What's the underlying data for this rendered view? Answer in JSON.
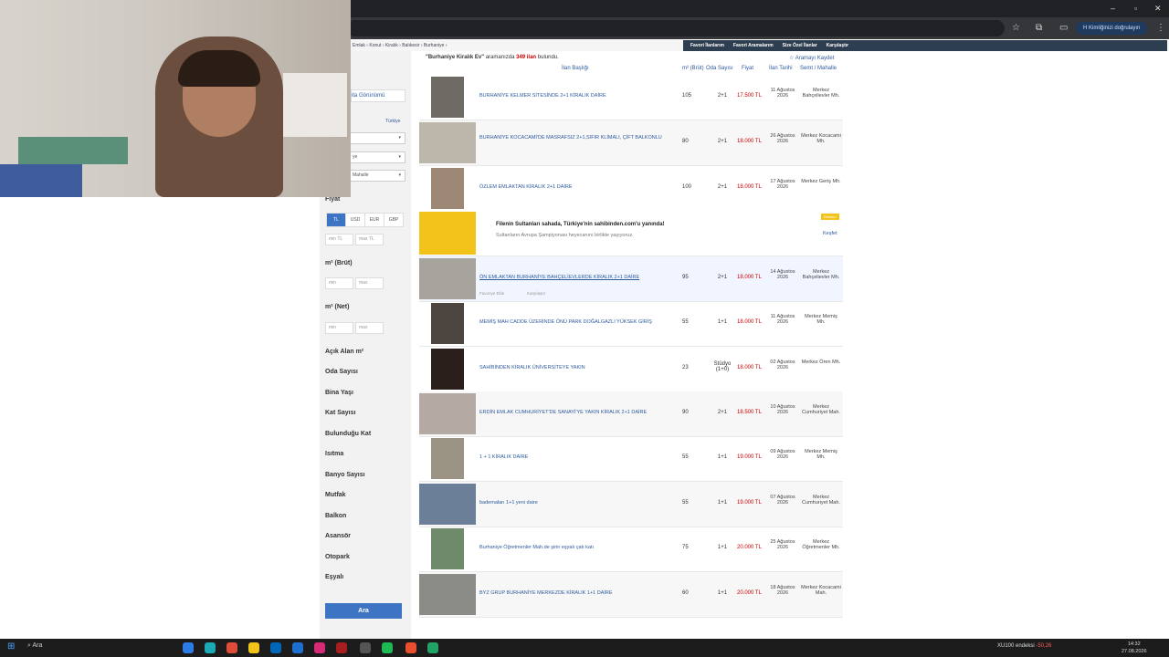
{
  "browser": {
    "verify_label": "Kimliğinizi doğrulayın",
    "avatar_letter": "H"
  },
  "breadcrumb": [
    "Emlak",
    "Konut",
    "Kiralık",
    "Balıkesir",
    "Burhaniye"
  ],
  "fav_links": [
    "Favori İlanlarım",
    "Favori Aramalarım",
    "Size Özel İlanlar",
    "Karşılaştır"
  ],
  "search_info": {
    "query": "\"Burhaniye Kiralık Ev\"",
    "prefix": "aramanızda",
    "count": "349 ilan",
    "suffix": "bulundu.",
    "save": "Aramayı Kaydet"
  },
  "sidebar": {
    "map_view": "ita Görünümü",
    "country": "Türkiye",
    "select2": "ye",
    "neighborhood": "Mahalle",
    "price_label": "Fiyat",
    "currencies": [
      "TL",
      "USD",
      "EUR",
      "GBP"
    ],
    "min_tl": "min TL",
    "max_tl": "max TL",
    "m2_brut": "m² (Brüt)",
    "m2_net": "m² (Net)",
    "min": "min",
    "max": "max",
    "filters": [
      "Açık Alan m²",
      "Oda Sayısı",
      "Bina Yaşı",
      "Kat Sayısı",
      "Bulunduğu Kat",
      "Isıtma",
      "Banyo Sayısı",
      "Mutfak",
      "Balkon",
      "Asansör",
      "Otopark",
      "Eşyalı"
    ],
    "search_button": "Ara"
  },
  "table": {
    "headers": [
      "İlan Başlığı",
      "m² (Brüt)",
      "Oda Sayısı",
      "Fiyat",
      "İlan Tarihi",
      "Semt / Mahalle"
    ],
    "rows": [
      {
        "title": "BURHANİYE KELMER SİTESİNDE 2+1 KİRALIK DAİRE",
        "m2": "105",
        "room": "2+1",
        "price": "17.500 TL",
        "date": "11 Ağustos 2026",
        "loc": "Merkez Bahçelievler Mh."
      },
      {
        "title": "BURHANİYE KOCACAMİ'DE MASRAFSIZ 2+1,SIFIR KLİMALI, ÇİFT BALKONLU",
        "m2": "80",
        "room": "2+1",
        "price": "18.000 TL",
        "date": "26 Ağustos 2026",
        "loc": "Merkez Kocacami Mh."
      },
      {
        "title": "ÖZLEM EMLAKTAN KİRALIK 2+1 DAİRE",
        "m2": "100",
        "room": "2+1",
        "price": "18.000 TL",
        "date": "17 Ağustos 2026",
        "loc": "Merkez Geriş Mh."
      },
      {
        "title": "ÖN EMLAKTAN BURHANİYE BAHÇELİEVLERDE KİRALIK 2+1 DAİRE",
        "m2": "95",
        "room": "2+1",
        "price": "18.000 TL",
        "date": "14 Ağustos 2026",
        "loc": "Merkez Bahçelievler Mh."
      },
      {
        "title": "MEMİŞ MAH CADDE ÜZERİNDE ÖNÜ PARK DOĞALGAZLI YÜKSEK GİRİŞ",
        "m2": "55",
        "room": "1+1",
        "price": "18.000 TL",
        "date": "11 Ağustos 2026",
        "loc": "Merkez Memiş Mh."
      },
      {
        "title": "SAHİBİNDEN KİRALIK ÜNİVERSİTEYE YAKIN",
        "m2": "23",
        "room": "Stüdyo (1+0)",
        "price": "18.000 TL",
        "date": "02 Ağustos 2026",
        "loc": "Merkez Ören Mh."
      },
      {
        "title": "ERDİN EMLAK CUMHURİYET'DE SANAYİ'YE YAKIN KİRALIK 2+1 DAİRE",
        "m2": "90",
        "room": "2+1",
        "price": "18.500 TL",
        "date": "10 Ağustos 2026",
        "loc": "Merkez Cumhuriyet Mah."
      },
      {
        "title": "1 + 1 KİRALIK DAİRE",
        "m2": "55",
        "room": "1+1",
        "price": "19.000 TL",
        "date": "09 Ağustos 2026",
        "loc": "Merkez Memiş Mh."
      },
      {
        "title": "bademaları 1+1 yeni daire",
        "m2": "55",
        "room": "1+1",
        "price": "19.000 TL",
        "date": "07 Ağustos 2026",
        "loc": "Merkez Cumhuriyet Mah."
      },
      {
        "title": "Burhaniye Öğretmenler Mah.de şirin eşyalı çatı katı",
        "m2": "75",
        "room": "1+1",
        "price": "20.000 TL",
        "date": "25 Ağustos 2026",
        "loc": "Merkez Öğretmenler Mh."
      },
      {
        "title": "BYZ GRUP BURHANİYE MERKEZDE KİRALIK 1+1 DAİRE",
        "m2": "60",
        "room": "1+1",
        "price": "20.000 TL",
        "date": "18 Ağustos 2026",
        "loc": "Merkez Kocacami Mah."
      }
    ],
    "ad": {
      "line1": "Filenin Sultanları sahada, Türkiye'nin sahibinden.com'u yanında!",
      "line2": "Sultanların Avrupa Şampiyonası heyecanını birlikte yaşıyoruz.",
      "badge": "Reklam",
      "cta": "Keşfet"
    },
    "row_actions": [
      "Favoriye Ekle",
      "Karşılaştır"
    ]
  },
  "taskbar": {
    "search": "Ara",
    "ticker": "XU100 endeksi",
    "ticker_value": "-50,26",
    "time": "14:32",
    "date": "27.08.2026"
  }
}
